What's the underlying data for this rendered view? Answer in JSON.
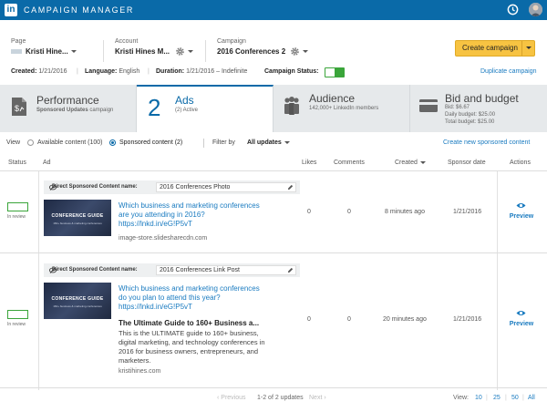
{
  "header": {
    "app_title": "CAMPAIGN MANAGER",
    "logo_text": "in"
  },
  "account_bar": {
    "page_label": "Page",
    "page_value": "Kristi Hine...",
    "account_label": "Account",
    "account_value": "Kristi Hines M...",
    "campaign_label": "Campaign",
    "campaign_value": "2016 Conferences 2",
    "create_campaign_label": "Create campaign"
  },
  "info_bar": {
    "created_label": "Created:",
    "created_value": "1/21/2016",
    "language_label": "Language:",
    "language_value": "English",
    "duration_label": "Duration:",
    "duration_value": "1/21/2016 – Indefinite",
    "status_label": "Campaign Status:",
    "duplicate_label": "Duplicate campaign"
  },
  "tabs": {
    "performance": {
      "title": "Performance",
      "sub_bold": "Sponsored Updates",
      "sub_rest": " campaign"
    },
    "ads": {
      "number": "2",
      "title": "Ads",
      "sub": "(2) Active"
    },
    "audience": {
      "title": "Audience",
      "sub": "142,000+ LinkedIn members"
    },
    "budget": {
      "title": "Bid and budget",
      "bid": "Bid:  $6.67",
      "daily": "Daily budget:  $25.00",
      "total": "Total budget:  $25.00"
    }
  },
  "filter_bar": {
    "view_label": "View",
    "available_label": "Available content (100)",
    "sponsored_label": "Sponsored content (2)",
    "filter_label": "Filter by",
    "filter_value": "All updates",
    "create_sponsored_label": "Create new sponsored content"
  },
  "table": {
    "headers": {
      "status": "Status",
      "ad": "Ad",
      "likes": "Likes",
      "comments": "Comments",
      "created": "Created",
      "sponsor_date": "Sponsor date",
      "actions": "Actions"
    },
    "rows": [
      {
        "status": "In review",
        "name_label": "Direct Sponsored Content name:",
        "name_value": "2016 Conferences Photo",
        "thumb_title": "CONFERENCE GUIDE",
        "thumb_sub": "160+ business & marketing conferences",
        "text_line1": "Which business and marketing conferences",
        "text_line2": "are you attending in 2016?",
        "text_link": "https://lnkd.in/eG!P5vT",
        "domain": "image-store.slidesharecdn.com",
        "likes": "0",
        "comments": "0",
        "created": "8 minutes ago",
        "sponsor_date": "1/21/2016",
        "action": "Preview"
      },
      {
        "status": "In review",
        "name_label": "Direct Sponsored Content name:",
        "name_value": "2016 Conferences Link Post",
        "thumb_title": "CONFERENCE GUIDE",
        "thumb_sub": "160+ business & marketing conferences",
        "text_line1": "Which business and marketing conferences",
        "text_line2": "do you plan to attend this year?",
        "text_link": "https://lnkd.in/eG!P5vT",
        "headline": "The Ultimate Guide to 160+ Business a...",
        "desc": "This is the ULTIMATE guide to 160+ business, digital marketing, and technology conferences in 2016 for business owners, entrepreneurs, and marketers.",
        "domain": "kristihines.com",
        "likes": "0",
        "comments": "0",
        "created": "20 minutes ago",
        "sponsor_date": "1/21/2016",
        "action": "Preview"
      }
    ]
  },
  "pagination": {
    "previous": "‹ Previous",
    "summary": "1-2 of 2 updates",
    "next": "Next ›",
    "view_label": "View:",
    "sizes": [
      "10",
      "25",
      "50",
      "All"
    ]
  },
  "colors": {
    "brand": "#0a6aa8",
    "accent": "#f7c342",
    "status_green": "#3aa53a",
    "link": "#1a7bc0"
  }
}
